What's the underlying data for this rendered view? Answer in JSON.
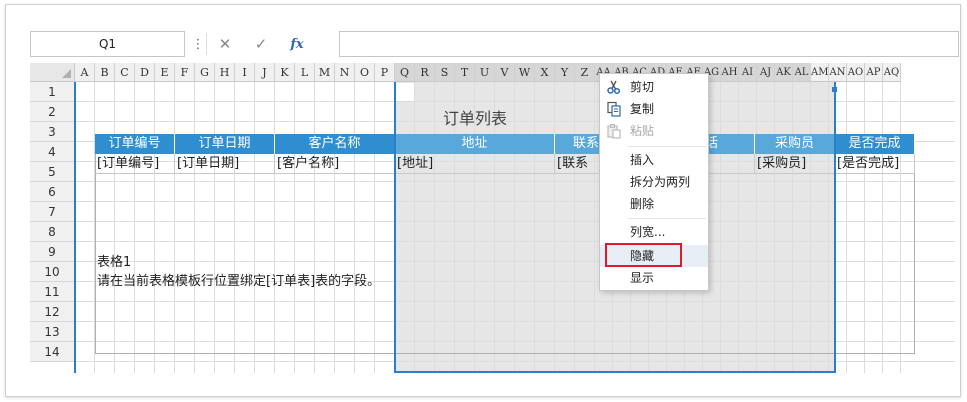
{
  "formula_bar": {
    "name_box": "Q1",
    "menu_dots": "⋮",
    "cancel_symbol": "✕",
    "confirm_symbol": "✓",
    "function_symbol": "fx",
    "formula_value": ""
  },
  "columns": [
    "A",
    "B",
    "C",
    "D",
    "E",
    "F",
    "G",
    "H",
    "I",
    "J",
    "K",
    "L",
    "M",
    "N",
    "O",
    "P",
    "Q",
    "R",
    "S",
    "T",
    "U",
    "V",
    "W",
    "X",
    "Y",
    "Z",
    "AA",
    "AB",
    "AC",
    "AD",
    "AE",
    "AF",
    "AG",
    "AH",
    "AI",
    "AJ",
    "AK",
    "AL",
    "AM",
    "AN",
    "AO",
    "AP",
    "AQ"
  ],
  "rows": [
    "1",
    "2",
    "3",
    "4",
    "5",
    "6",
    "7",
    "8",
    "9",
    "10",
    "11",
    "12",
    "13",
    "14"
  ],
  "sheet": {
    "table_title": "订单列表",
    "headers": [
      "订单编号",
      "订单日期",
      "客户名称",
      "地址",
      "联系",
      "话",
      "采购员",
      "是否完成"
    ],
    "fields": [
      "[订单编号]",
      "[订单日期]",
      "[客户名称]",
      "[地址]",
      "[联系",
      "]",
      "[采购员]",
      "[是否完成]"
    ],
    "note_title": "表格1",
    "note_text": "请在当前表格模板行位置绑定[订单表]表的字段。"
  },
  "context_menu": {
    "items": [
      {
        "label": "剪切",
        "icon": "scissors-icon",
        "enabled": true
      },
      {
        "label": "复制",
        "icon": "copy-icon",
        "enabled": true
      },
      {
        "label": "粘贴",
        "icon": "paste-icon",
        "enabled": false
      },
      {
        "label": "插入",
        "icon": "",
        "enabled": true
      },
      {
        "label": "拆分为两列",
        "icon": "",
        "enabled": true
      },
      {
        "label": "删除",
        "icon": "",
        "enabled": true
      },
      {
        "label": "列宽...",
        "icon": "",
        "enabled": true
      },
      {
        "label": "隐藏",
        "icon": "",
        "enabled": true,
        "highlighted": true
      },
      {
        "label": "显示",
        "icon": "",
        "enabled": true
      }
    ]
  },
  "colors": {
    "header_blue": "#2f8ed0",
    "selection_border": "#2d7ec9",
    "highlight_box": "#e0192d"
  }
}
